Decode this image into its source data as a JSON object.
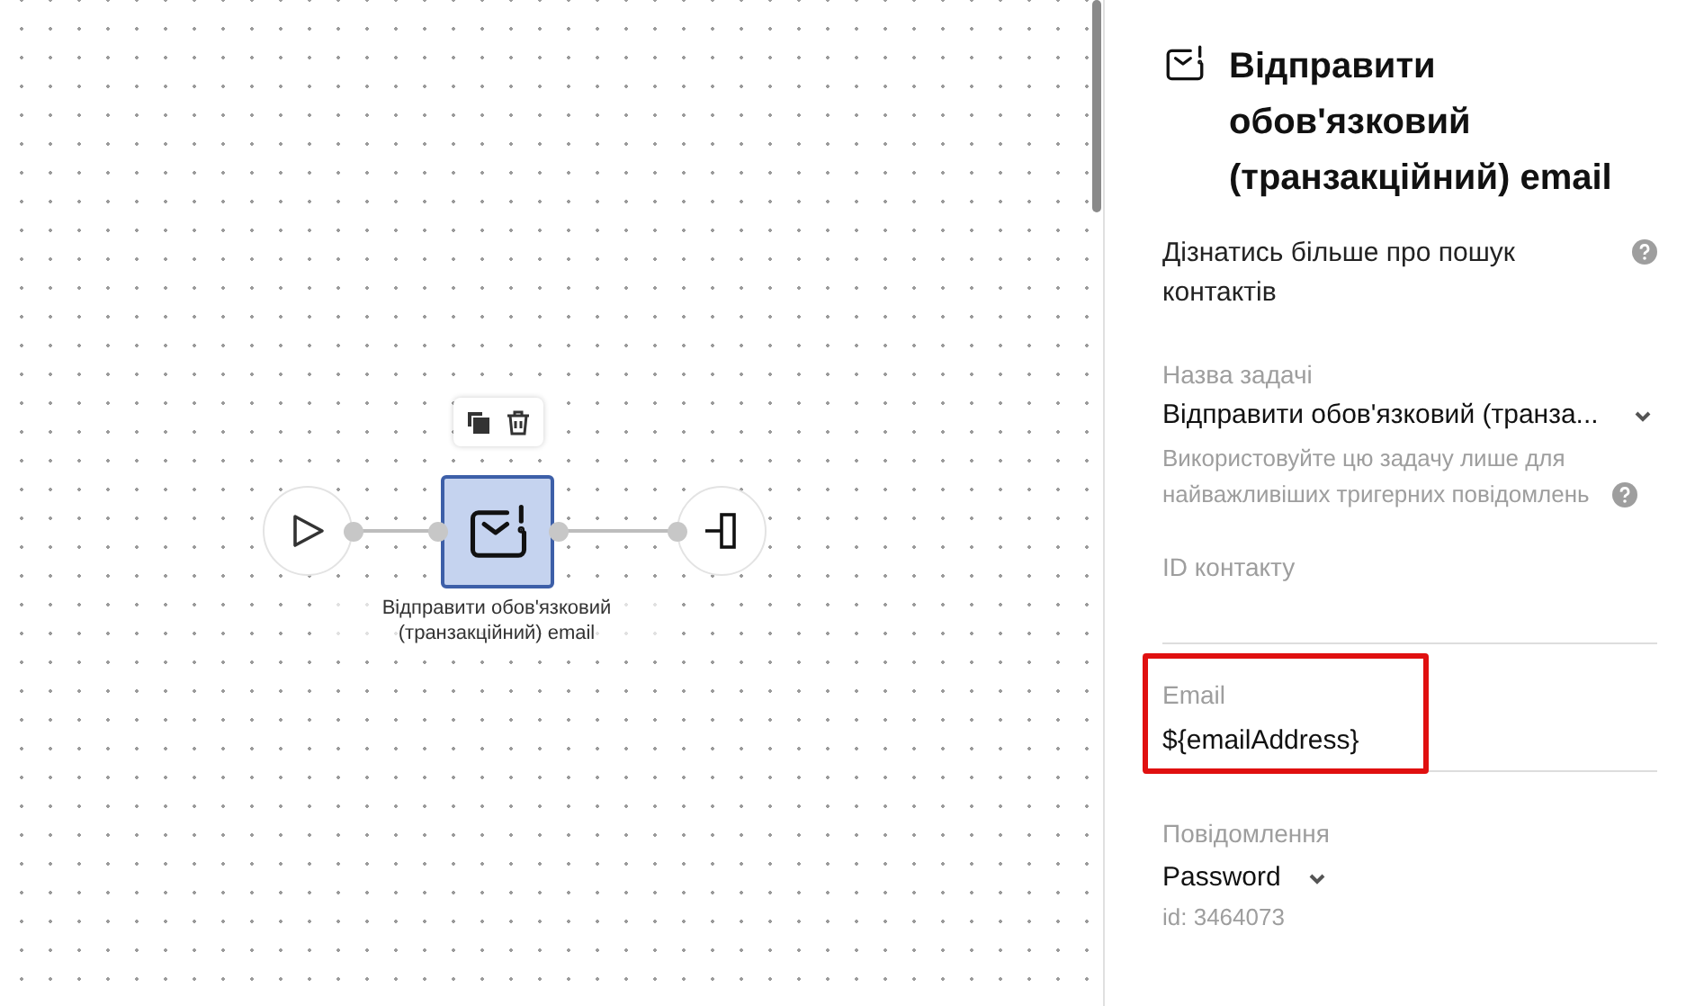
{
  "canvas": {
    "nodes": [
      {
        "kind": "start",
        "selected": false
      },
      {
        "kind": "task",
        "selected": true,
        "label": "Відправити обов'язковий (транзакційний) email"
      },
      {
        "kind": "end",
        "selected": false
      }
    ]
  },
  "panel": {
    "title": "Відправити обов'язковий (транзакційний) email",
    "fields": [
      {
        "kind": "help",
        "text": "Дізнатись більше про пошук контактів"
      },
      {
        "kind": "select",
        "label": "Назва задачі",
        "value": "Відправити обов'язковий (транза...",
        "hint": "Використовуйте цю задачу лише для найважливіших тригерних повідомлень"
      },
      {
        "kind": "input",
        "label": "ID контакту",
        "highlighted": false
      },
      {
        "kind": "input",
        "label": "Email",
        "value": "${emailAddress}",
        "highlighted": true
      },
      {
        "kind": "dropdown",
        "label": "Повідомлення",
        "value": "Password",
        "hint": "id: 3464073"
      }
    ]
  }
}
